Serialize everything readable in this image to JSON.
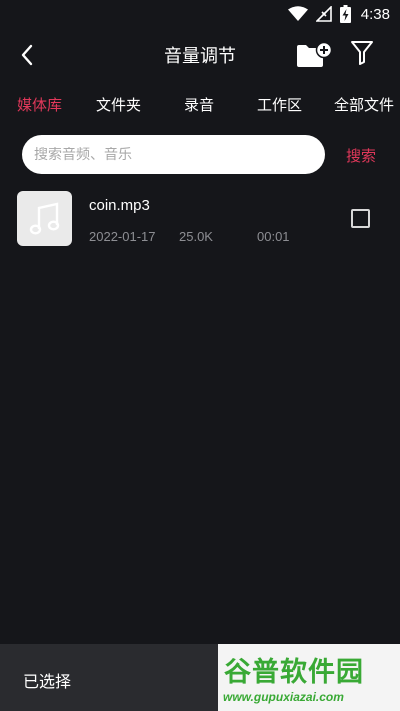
{
  "status_bar": {
    "time": "4:38"
  },
  "app_bar": {
    "title": "音量调节"
  },
  "tabs": [
    {
      "label": "媒体库"
    },
    {
      "label": "文件夹"
    },
    {
      "label": "录音"
    },
    {
      "label": "工作区"
    },
    {
      "label": "全部文件"
    }
  ],
  "search": {
    "placeholder": "搜索音频、音乐",
    "button_label": "搜索",
    "value": ""
  },
  "files": [
    {
      "name": "coin.mp3",
      "date": "2022-01-17",
      "size": "25.0K",
      "duration": "00:01"
    }
  ],
  "bottom_bar": {
    "selected_label": "已选择"
  },
  "watermark": {
    "title": "谷普软件园",
    "url": "www.gupuxiazai.com"
  },
  "colors": {
    "accent": "#e0385a",
    "background": "#15161a",
    "bottom_bar": "#2a2b2f",
    "watermark_green": "#39a935"
  }
}
